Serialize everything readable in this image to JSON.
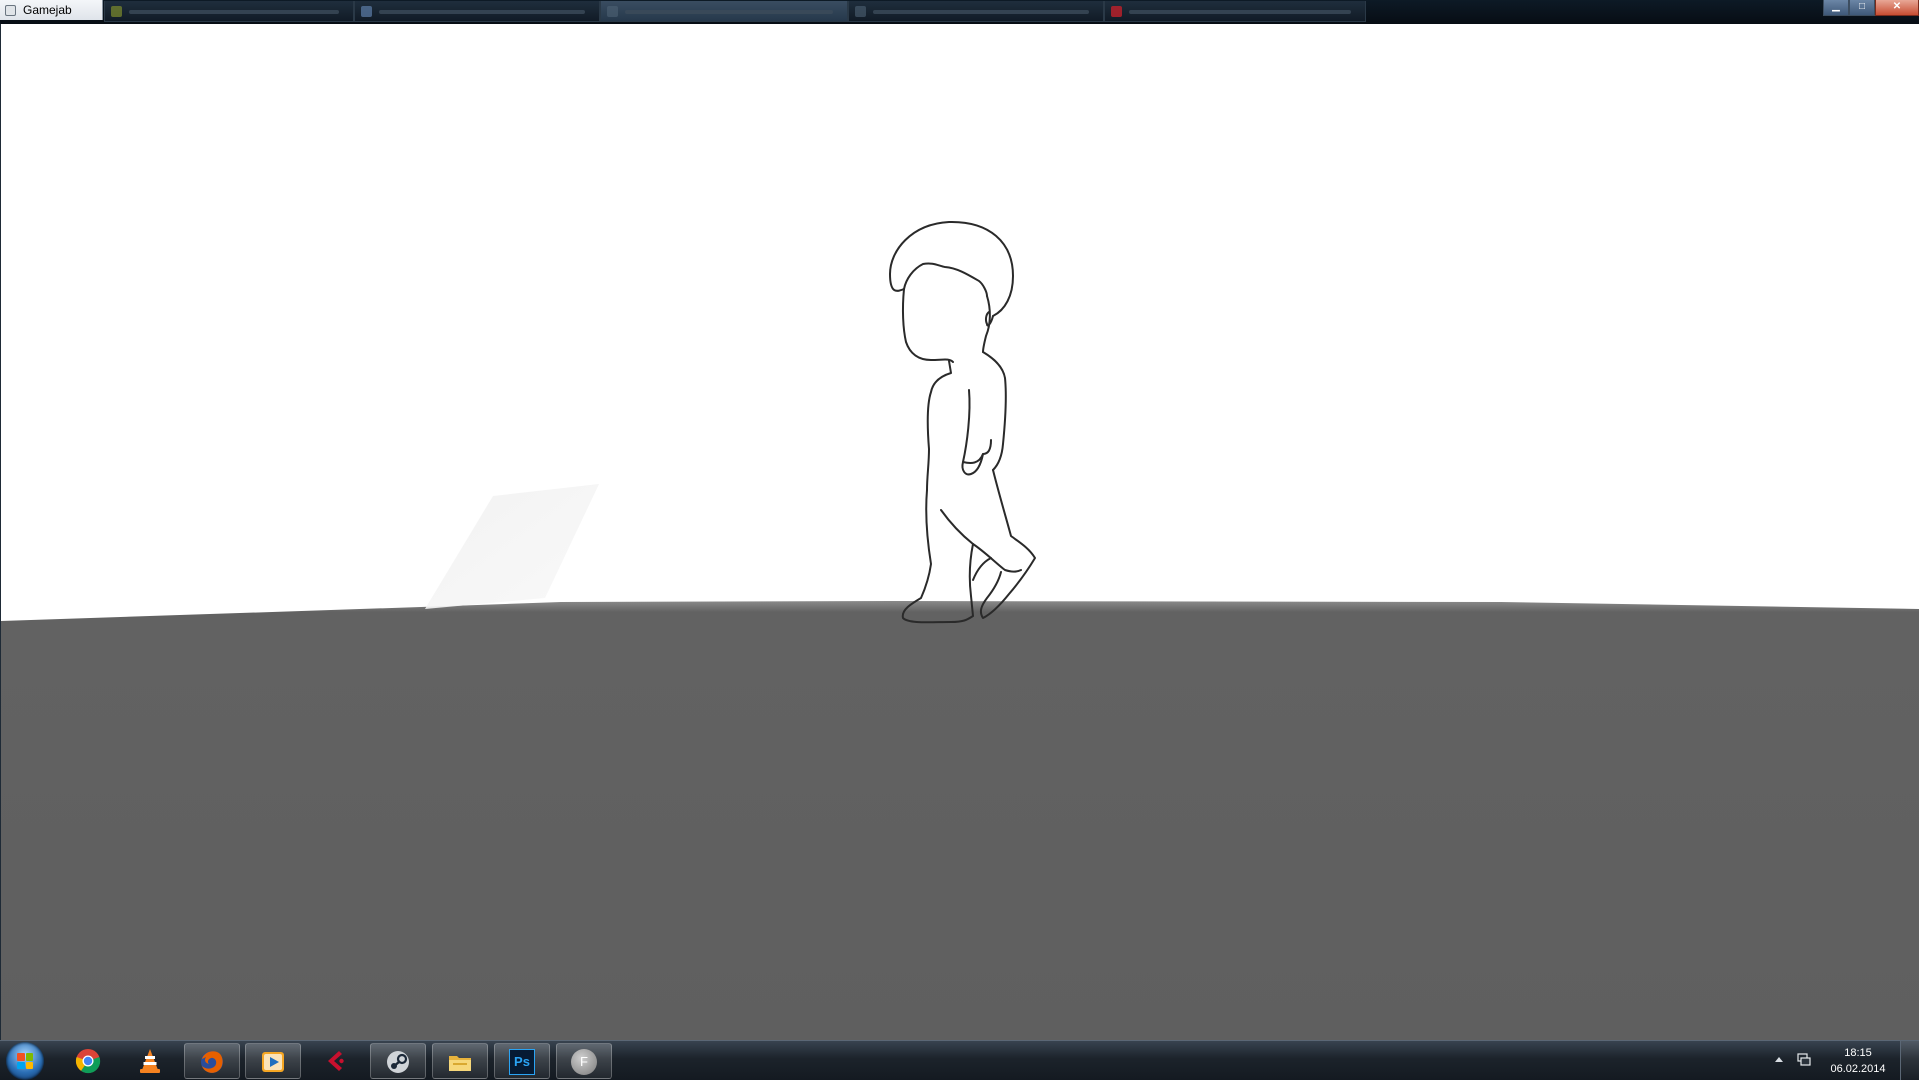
{
  "window": {
    "title": "Gamejab",
    "controls": {
      "minimize": "▁",
      "maximize": "□",
      "close": "✕"
    }
  },
  "scene": {
    "sky_color": "#ffffff",
    "ground_color": "#5f5f5f",
    "character_outline_color": "#2a2a2a",
    "panel_color": "#f3f3f3"
  },
  "taskbar": {
    "pinned_apps": [
      {
        "icon": "chrome-icon",
        "running": false
      },
      {
        "icon": "vlc-icon",
        "running": false
      },
      {
        "icon": "firefox-icon",
        "running": true
      },
      {
        "icon": "media-player-icon",
        "running": true
      },
      {
        "icon": "codebook-icon",
        "running": false
      },
      {
        "icon": "steam-icon",
        "running": true
      },
      {
        "icon": "file-explorer-icon",
        "running": true
      },
      {
        "icon": "photoshop-icon",
        "running": true
      },
      {
        "icon": "flash-icon",
        "running": true
      }
    ],
    "photoshop_label": "Ps",
    "flash_label": "F",
    "clock": {
      "time": "18:15",
      "date": "06.02.2014"
    }
  }
}
